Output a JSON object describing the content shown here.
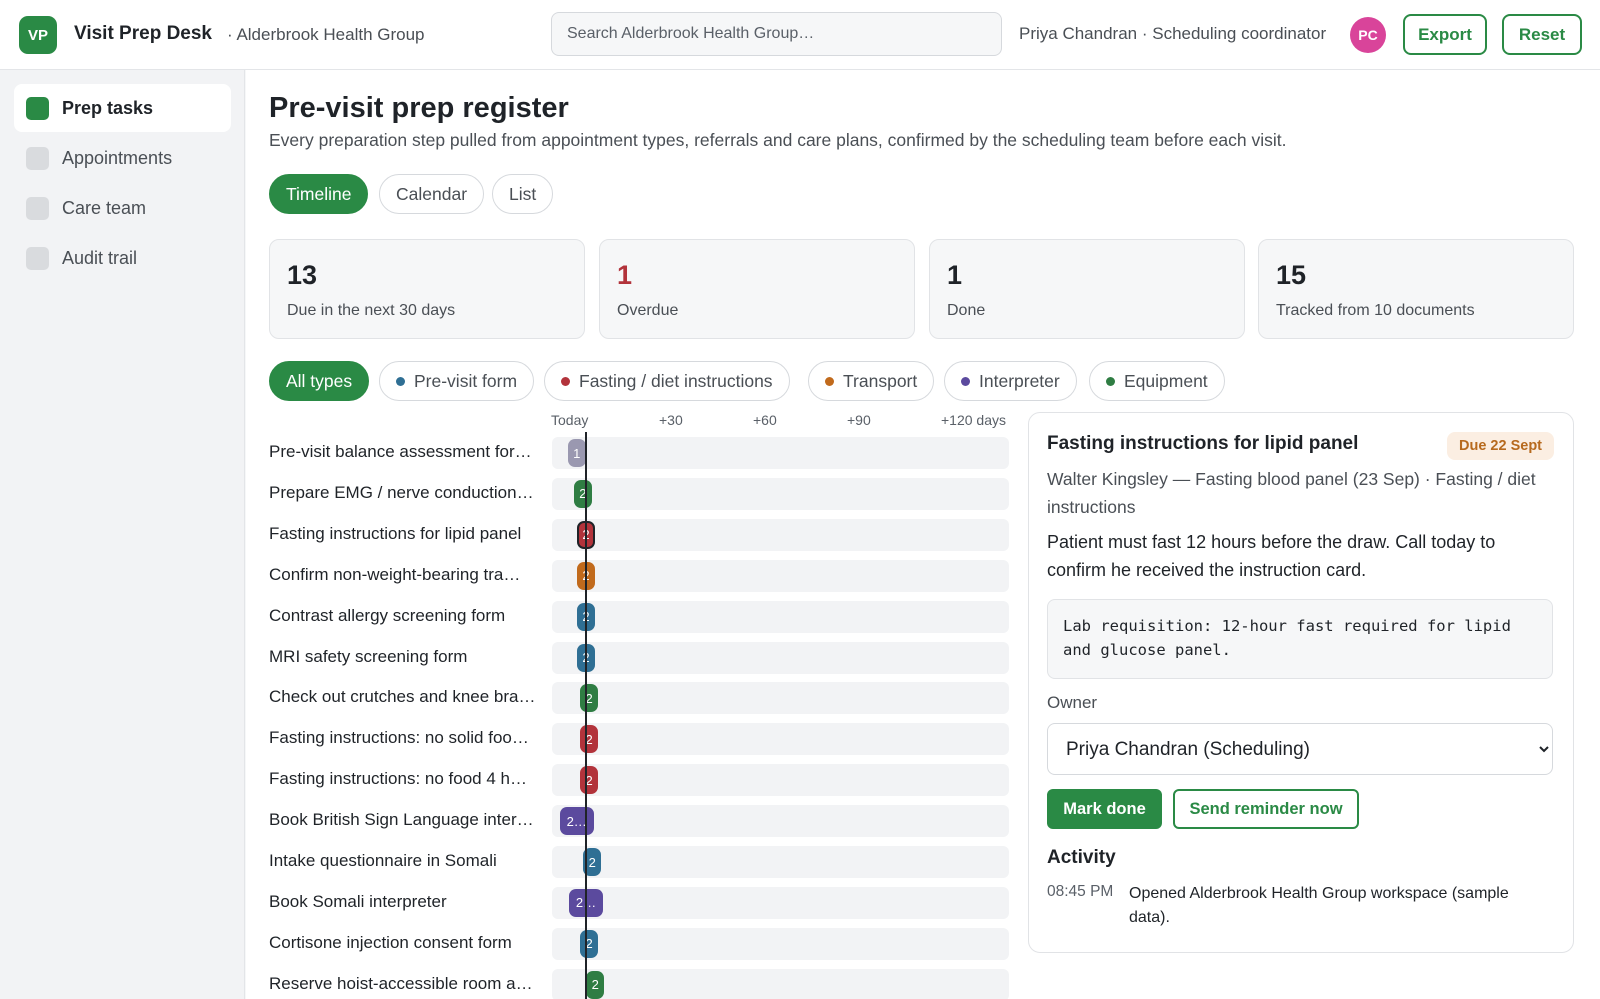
{
  "header": {
    "logo": "VP",
    "app_name": "Visit Prep Desk",
    "org": "· Alderbrook Health Group",
    "search_placeholder": "Search Alderbrook Health Group…",
    "user": "Priya Chandran · Scheduling coordinator",
    "avatar": "PC",
    "export": "Export",
    "reset": "Reset"
  },
  "sidebar": {
    "items": [
      {
        "label": "Prep tasks",
        "active": true
      },
      {
        "label": "Appointments",
        "active": false
      },
      {
        "label": "Care team",
        "active": false
      },
      {
        "label": "Audit trail",
        "active": false
      }
    ]
  },
  "page": {
    "title": "Pre-visit prep register",
    "subtitle": "Every preparation step pulled from appointment types, referrals and care plans, confirmed by the scheduling team before each visit.",
    "views": [
      "Timeline",
      "Calendar",
      "List"
    ],
    "active_view": "Timeline"
  },
  "stats": [
    {
      "value": "13",
      "label": "Due in the next 30 days"
    },
    {
      "value": "1",
      "label": "Overdue"
    },
    {
      "value": "1",
      "label": "Done"
    },
    {
      "value": "15",
      "label": "Tracked from 10 documents"
    }
  ],
  "filters": [
    {
      "label": "All types",
      "active": true,
      "color": ""
    },
    {
      "label": "Pre-visit form",
      "active": false,
      "color": "#2f6f94"
    },
    {
      "label": "Fasting / diet instructions",
      "active": false,
      "color": "#b2333b"
    },
    {
      "label": "Transport",
      "active": false,
      "color": "#c16a1c"
    },
    {
      "label": "Interpreter",
      "active": false,
      "color": "#5b4a9e"
    },
    {
      "label": "Equipment",
      "active": false,
      "color": "#2f7d43"
    }
  ],
  "timeline": {
    "axis_labels": [
      "Today",
      "+30",
      "+60",
      "+90",
      "+120 days"
    ],
    "rows": [
      {
        "label": "Pre-visit balance assessment for…",
        "mark": "1",
        "day": -3,
        "color": "#9a98b0",
        "selected": false
      },
      {
        "label": "Prepare EMG / nerve conduction …",
        "mark": "2",
        "day": -1,
        "color": "#2f7d43",
        "selected": false
      },
      {
        "label": "Fasting instructions for lipid panel",
        "mark": "2",
        "day": 0,
        "color": "#b2333b",
        "selected": true
      },
      {
        "label": "Confirm non-weight-bearing tra…",
        "mark": "2",
        "day": 0,
        "color": "#c16a1c",
        "selected": false
      },
      {
        "label": "Contrast allergy screening form",
        "mark": "2",
        "day": 0,
        "color": "#2f6f94",
        "selected": false
      },
      {
        "label": "MRI safety screening form",
        "mark": "2",
        "day": 0,
        "color": "#2f6f94",
        "selected": false
      },
      {
        "label": "Check out crutches and knee bra…",
        "mark": "2",
        "day": 1,
        "color": "#2f7d43",
        "selected": false
      },
      {
        "label": "Fasting instructions: no solid foo…",
        "mark": "2",
        "day": 1,
        "color": "#b2333b",
        "selected": false
      },
      {
        "label": "Fasting instructions: no food 4 h…",
        "mark": "2",
        "day": 1,
        "color": "#b2333b",
        "selected": false
      },
      {
        "label": "Book British Sign Language inter…",
        "mark": "2…",
        "day": -3,
        "color": "#5b4a9e",
        "selected": false
      },
      {
        "label": "Intake questionnaire in Somali",
        "mark": "2",
        "day": 2,
        "color": "#2f6f94",
        "selected": false
      },
      {
        "label": "Book Somali interpreter",
        "mark": "2…",
        "day": 0,
        "color": "#5b4a9e",
        "selected": false
      },
      {
        "label": "Cortisone injection consent form",
        "mark": "2",
        "day": 1,
        "color": "#2f6f94",
        "selected": false
      },
      {
        "label": "Reserve hoist-accessible room a…",
        "mark": "2",
        "day": 3,
        "color": "#2f7d43",
        "selected": false
      }
    ]
  },
  "detail": {
    "title": "Fasting instructions for lipid panel",
    "due": "Due 22 Sept",
    "meta": "Walter Kingsley — Fasting blood panel (23 Sep) · Fasting / diet instructions",
    "description": "Patient must fast 12 hours before the draw. Call today to confirm he received the instruction card.",
    "source_excerpt": "Lab requisition: 12-hour fast required for lipid and glucose panel.",
    "owner_label": "Owner",
    "owner_value": "Priya Chandran (Scheduling)",
    "mark_done": "Mark done",
    "send_reminder": "Send reminder now",
    "activity_heading": "Activity",
    "activity": [
      {
        "time": "08:45 PM",
        "text": "Opened Alderbrook Health Group workspace (sample data)."
      }
    ]
  }
}
